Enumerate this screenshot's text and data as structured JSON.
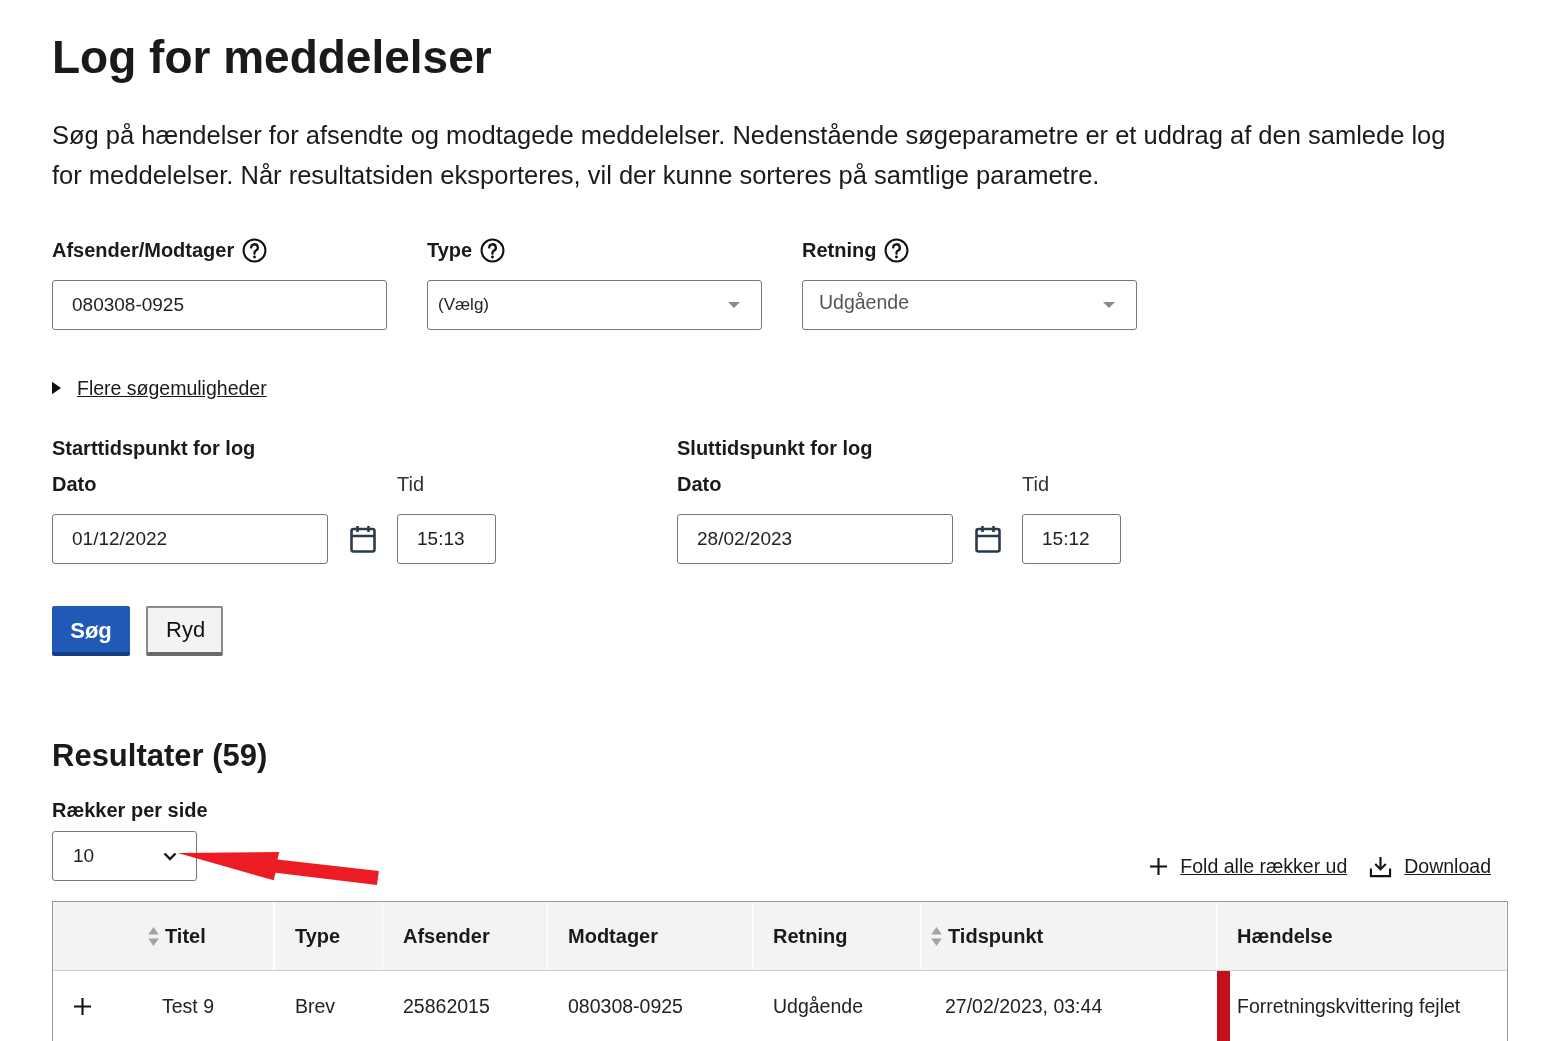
{
  "page": {
    "title": "Log for meddelelser",
    "intro": "Søg på hændelser for afsendte og modtagede meddelelser. Nedenstående søgeparametre er et uddrag af den samlede log for meddelelser. Når resultatsiden eksporteres, vil der kunne sorteres på samtlige parametre."
  },
  "filters": [
    {
      "label": "Afsender/Modtager",
      "help": true,
      "kind": "input",
      "value": "080308-0925"
    },
    {
      "label": "Type",
      "help": true,
      "kind": "select",
      "placeholder": "(Vælg)"
    },
    {
      "label": "Retning",
      "help": true,
      "kind": "select",
      "value": "Udgående"
    }
  ],
  "more_options": {
    "label": "Flere søgemuligheder",
    "expanded": false
  },
  "periods": [
    {
      "heading": "Starttidspunkt for log",
      "date_label": "Dato",
      "time_label": "Tid",
      "date": "01/12/2022",
      "time": "15:13"
    },
    {
      "heading": "Sluttidspunkt for log",
      "date_label": "Dato",
      "time_label": "Tid",
      "date": "28/02/2023",
      "time": "15:12"
    }
  ],
  "buttons": [
    {
      "label": "Søg",
      "kind": "primary"
    },
    {
      "label": "Ryd",
      "kind": "secondary"
    }
  ],
  "results": {
    "heading": "Resultater (59)",
    "rows_per_page_label": "Rækker per side",
    "rows_per_page": "10",
    "actions": [
      {
        "label": "Fold alle rækker ud",
        "kind": "expand"
      },
      {
        "label": "Download",
        "kind": "download"
      }
    ]
  },
  "table": {
    "columns": [
      {
        "label": "Titel",
        "sortable": true
      },
      {
        "label": "Type",
        "sortable": false
      },
      {
        "label": "Afsender",
        "sortable": false
      },
      {
        "label": "Modtager",
        "sortable": false
      },
      {
        "label": "Retning",
        "sortable": false
      },
      {
        "label": "Tidspunkt",
        "sortable": true
      },
      {
        "label": "Hændelse",
        "sortable": false
      }
    ],
    "rows": [
      {
        "expanded": false,
        "cells": [
          "Test 9",
          "Brev",
          "25862015",
          "080308-0925",
          "Udgående",
          "27/02/2023, 03:44",
          "Forretningskvittering fejlet"
        ],
        "color": "#c2101c"
      }
    ]
  }
}
